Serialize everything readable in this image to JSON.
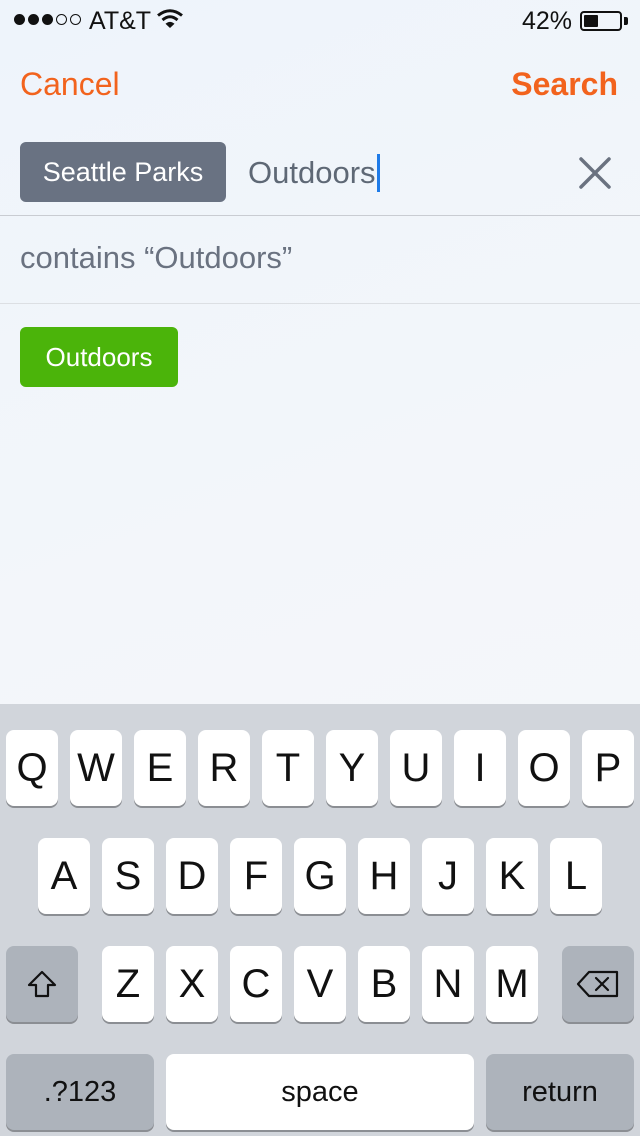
{
  "status_bar": {
    "carrier": "AT&T",
    "signal_bars_filled": 3,
    "signal_bars_total": 5,
    "battery_percent_text": "42%",
    "battery_level": 0.42
  },
  "nav": {
    "cancel_label": "Cancel",
    "search_label": "Search",
    "accent_color": "#f2631d"
  },
  "search": {
    "scope_chip": "Seattle Parks",
    "query": "Outdoors"
  },
  "suggestion": {
    "contains_text": "contains “Outdoors”",
    "tag_label": "Outdoors",
    "tag_color": "#4bb40a"
  },
  "keyboard": {
    "row1": [
      "Q",
      "W",
      "E",
      "R",
      "T",
      "Y",
      "U",
      "I",
      "O",
      "P"
    ],
    "row2": [
      "A",
      "S",
      "D",
      "F",
      "G",
      "H",
      "J",
      "K",
      "L"
    ],
    "row3": [
      "Z",
      "X",
      "C",
      "V",
      "B",
      "N",
      "M"
    ],
    "numbers_label": ".?123",
    "space_label": "space",
    "return_label": "return",
    "shift_icon": "shift-icon",
    "delete_icon": "delete-icon"
  }
}
